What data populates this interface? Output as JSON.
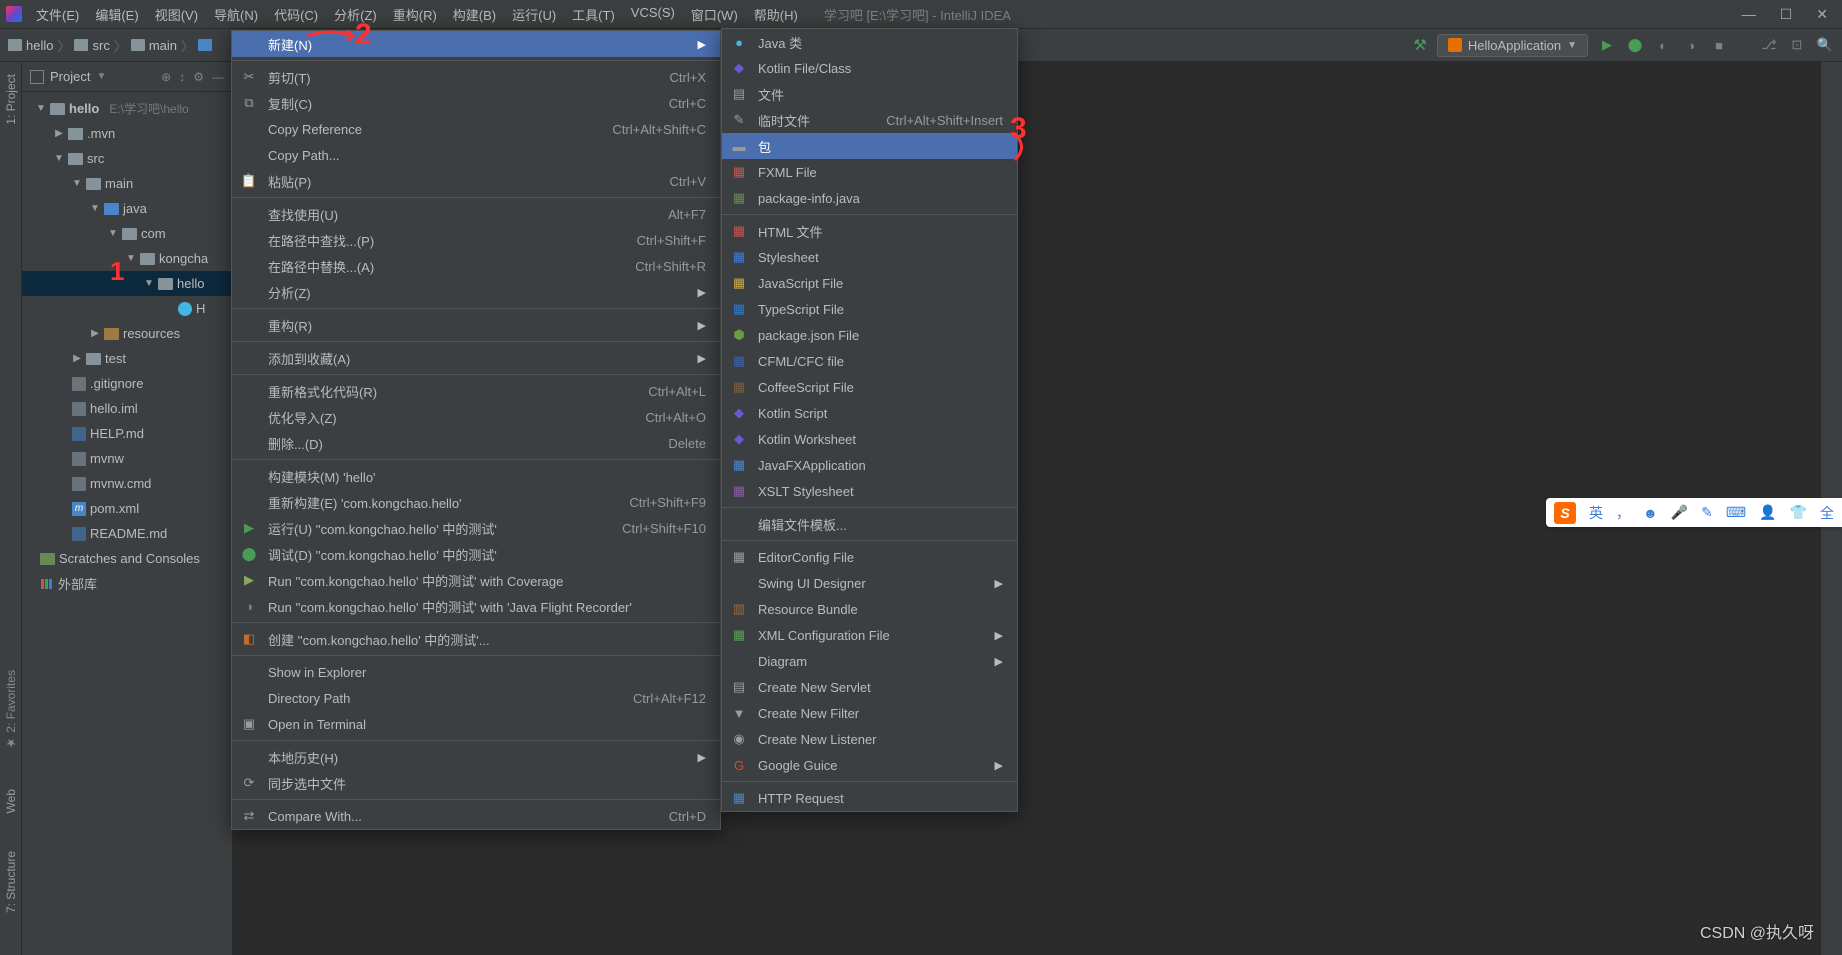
{
  "title": {
    "project": "学习吧 [E:\\学习吧]",
    "app": "IntelliJ IDEA"
  },
  "menubar": [
    "文件(E)",
    "编辑(E)",
    "视图(V)",
    "导航(N)",
    "代码(C)",
    "分析(Z)",
    "重构(R)",
    "构建(B)",
    "运行(U)",
    "工具(T)",
    "VCS(S)",
    "窗口(W)",
    "帮助(H)"
  ],
  "breadcrumbs": [
    "hello",
    "src",
    "main"
  ],
  "run_config": {
    "name": "HelloApplication"
  },
  "sidebar": {
    "title": "Project"
  },
  "tree": {
    "hello": "hello",
    "hello_hint": "E:\\学习吧\\hello",
    "mvn": ".mvn",
    "src": "src",
    "main": "main",
    "java": "java",
    "com": "com",
    "kongchao": "kongcha",
    "hello2": "hello",
    "h_class": "H",
    "resources": "resources",
    "test": "test",
    "gitignore": ".gitignore",
    "iml": "hello.iml",
    "help": "HELP.md",
    "mvnw": "mvnw",
    "mvnwcmd": "mvnw.cmd",
    "pom": "pom.xml",
    "readme": "README.md",
    "scratches": "Scratches and Consoles",
    "ext": "外部库"
  },
  "gutter_left": [
    "1: Project",
    "2: Favorites",
    "Web",
    "7: Structure"
  ],
  "ctx1": [
    {
      "type": "hi",
      "icon": "",
      "label": "新建(N)",
      "arrow": true
    },
    {
      "type": "sep"
    },
    {
      "icon": "✂",
      "label": "剪切(T)",
      "sc": "Ctrl+X"
    },
    {
      "icon": "⧉",
      "label": "复制(C)",
      "sc": "Ctrl+C"
    },
    {
      "icon": "",
      "label": "Copy Reference",
      "sc": "Ctrl+Alt+Shift+C"
    },
    {
      "icon": "",
      "label": "Copy Path..."
    },
    {
      "icon": "📋",
      "label": "粘贴(P)",
      "sc": "Ctrl+V"
    },
    {
      "type": "sep"
    },
    {
      "icon": "",
      "label": "查找使用(U)",
      "sc": "Alt+F7"
    },
    {
      "icon": "",
      "label": "在路径中查找...(P)",
      "sc": "Ctrl+Shift+F"
    },
    {
      "icon": "",
      "label": "在路径中替换...(A)",
      "sc": "Ctrl+Shift+R"
    },
    {
      "icon": "",
      "label": "分析(Z)",
      "arrow": true
    },
    {
      "type": "sep"
    },
    {
      "icon": "",
      "label": "重构(R)",
      "arrow": true
    },
    {
      "type": "sep"
    },
    {
      "icon": "",
      "label": "添加到收藏(A)",
      "arrow": true
    },
    {
      "type": "sep"
    },
    {
      "icon": "",
      "label": "重新格式化代码(R)",
      "sc": "Ctrl+Alt+L"
    },
    {
      "icon": "",
      "label": "优化导入(Z)",
      "sc": "Ctrl+Alt+O"
    },
    {
      "icon": "",
      "label": "删除...(D)",
      "sc": "Delete"
    },
    {
      "type": "sep"
    },
    {
      "icon": "",
      "label": "构建模块(M) 'hello'"
    },
    {
      "icon": "",
      "label": "重新构建(E) 'com.kongchao.hello'",
      "sc": "Ctrl+Shift+F9"
    },
    {
      "icon": "▶",
      "iconColor": "#499c54",
      "label": "运行(U) ''com.kongchao.hello' 中的测试'",
      "sc": "Ctrl+Shift+F10"
    },
    {
      "icon": "⬤",
      "iconColor": "#499c54",
      "label": "调试(D) ''com.kongchao.hello' 中的测试'"
    },
    {
      "icon": "▶",
      "iconColor": "#8aa85f",
      "label": "Run ''com.kongchao.hello' 中的测试' with Coverage"
    },
    {
      "icon": "◑",
      "iconColor": "#808080",
      "label": "Run ''com.kongchao.hello' 中的测试' with 'Java Flight Recorder'"
    },
    {
      "type": "sep"
    },
    {
      "icon": "◧",
      "iconColor": "#c76b29",
      "label": "创建 ''com.kongchao.hello' 中的测试'..."
    },
    {
      "type": "sep"
    },
    {
      "icon": "",
      "label": "Show in Explorer"
    },
    {
      "icon": "",
      "label": "Directory Path",
      "sc": "Ctrl+Alt+F12"
    },
    {
      "icon": "▣",
      "label": "Open in Terminal"
    },
    {
      "type": "sep"
    },
    {
      "icon": "",
      "label": "本地历史(H)",
      "arrow": true
    },
    {
      "icon": "⟳",
      "label": "同步选中文件"
    },
    {
      "type": "sep"
    },
    {
      "icon": "⇄",
      "label": "Compare With...",
      "sc": "Ctrl+D"
    }
  ],
  "ctx2": [
    {
      "icon": "●",
      "iconColor": "#40b6e0",
      "label": "Java 类"
    },
    {
      "icon": "◆",
      "iconColor": "#6e57d2",
      "label": "Kotlin File/Class"
    },
    {
      "icon": "▤",
      "label": "文件"
    },
    {
      "icon": "✎",
      "label": "临时文件",
      "sc": "Ctrl+Alt+Shift+Insert"
    },
    {
      "type": "hi",
      "icon": "▬",
      "label": "包"
    },
    {
      "icon": "▦",
      "iconColor": "#c75450",
      "label": "FXML File"
    },
    {
      "icon": "▦",
      "iconColor": "#6a8759",
      "label": "package-info.java"
    },
    {
      "type": "sep"
    },
    {
      "icon": "▦",
      "iconColor": "#c75450",
      "label": "HTML 文件"
    },
    {
      "icon": "▦",
      "iconColor": "#3d7dd8",
      "label": "Stylesheet"
    },
    {
      "icon": "▦",
      "iconColor": "#c9a94a",
      "label": "JavaScript File"
    },
    {
      "icon": "▦",
      "iconColor": "#3178c6",
      "label": "TypeScript File"
    },
    {
      "icon": "⬢",
      "iconColor": "#6a9e3f",
      "label": "package.json File"
    },
    {
      "icon": "▦",
      "iconColor": "#3962a8",
      "label": "CFML/CFC file"
    },
    {
      "icon": "▦",
      "iconColor": "#7a5c3e",
      "label": "CoffeeScript File"
    },
    {
      "icon": "◆",
      "iconColor": "#6e57d2",
      "label": "Kotlin Script"
    },
    {
      "icon": "◆",
      "iconColor": "#6e57d2",
      "label": "Kotlin Worksheet"
    },
    {
      "icon": "▦",
      "iconColor": "#4a86c7",
      "label": "JavaFXApplication"
    },
    {
      "icon": "▦",
      "iconColor": "#8a5da6",
      "label": "XSLT Stylesheet"
    },
    {
      "type": "sep"
    },
    {
      "icon": "",
      "label": "编辑文件模板..."
    },
    {
      "type": "sep"
    },
    {
      "icon": "▦",
      "label": "EditorConfig File"
    },
    {
      "icon": "",
      "label": "Swing UI Designer",
      "arrow": true
    },
    {
      "icon": "▥",
      "iconColor": "#9e6b3a",
      "label": "Resource Bundle"
    },
    {
      "icon": "▦",
      "iconColor": "#5a9e5a",
      "label": "XML Configuration File",
      "arrow": true
    },
    {
      "icon": "",
      "label": "Diagram",
      "arrow": true
    },
    {
      "icon": "▤",
      "label": "Create New Servlet"
    },
    {
      "icon": "▼",
      "label": "Create New Filter"
    },
    {
      "icon": "◉",
      "label": "Create New Listener"
    },
    {
      "icon": "G",
      "iconColor": "#db4437",
      "label": "Google Guice",
      "arrow": true
    },
    {
      "type": "sep"
    },
    {
      "icon": "▦",
      "iconColor": "#4a86c7",
      "label": "HTTP Request"
    }
  ],
  "ime": [
    "英",
    "，",
    "☻",
    "🎤",
    "✎",
    "⌨",
    "👤",
    "👕",
    "全"
  ],
  "watermark": "CSDN @执久呀"
}
